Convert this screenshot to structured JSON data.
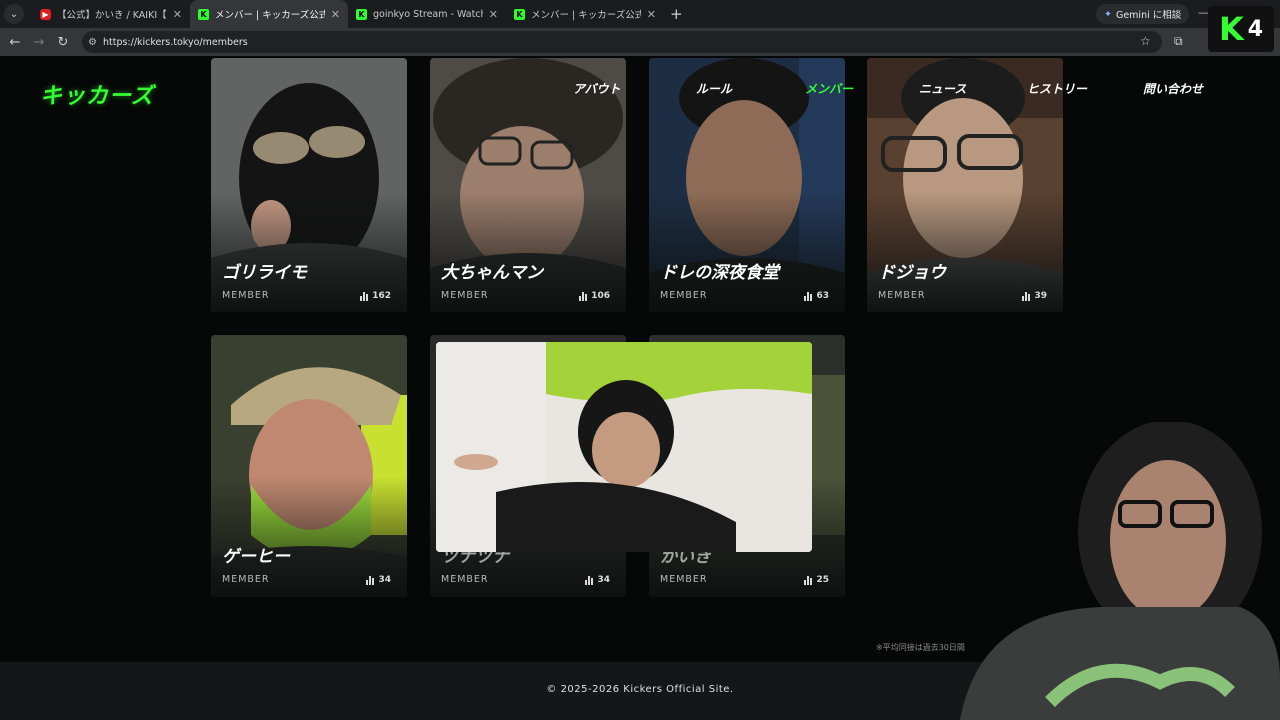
{
  "browser": {
    "tabs": [
      {
        "title": "【公式】かいき / KAIKI【キッカーズ 三",
        "icon": "youtube-icon",
        "active": false
      },
      {
        "title": "メンバー | キッカーズ公式サイト",
        "icon": "kickers-favicon",
        "active": true
      },
      {
        "title": "goinkyo Stream - Watch Live o",
        "icon": "kickers-favicon",
        "active": false
      },
      {
        "title": "メンバー | キッカーズ公式サイト",
        "icon": "kickers-favicon",
        "active": false
      }
    ],
    "gemini_label": "Gemini に相談",
    "url": "https://kickers.tokyo/members"
  },
  "site": {
    "logo": "キッカーズ",
    "nav": [
      "アバウト",
      "ルール",
      "メンバー",
      "ニュース",
      "ヒストリー",
      "問い合わせ"
    ],
    "active_nav": "メンバー"
  },
  "members": [
    {
      "name": "ゴリライモ",
      "role": "MEMBER",
      "count": "162"
    },
    {
      "name": "大ちゃんマン",
      "role": "MEMBER",
      "count": "106"
    },
    {
      "name": "ドレの深夜食堂",
      "role": "MEMBER",
      "count": "63"
    },
    {
      "name": "ドジョウ",
      "role": "MEMBER",
      "count": "39"
    },
    {
      "name": "ゲーヒー",
      "role": "MEMBER",
      "count": "34"
    },
    {
      "name": "ツナツナ",
      "role": "MEMBER",
      "count": "34"
    },
    {
      "name": "かいき",
      "role": "MEMBER",
      "count": "25"
    }
  ],
  "note": "※平均同接は過去30日間",
  "footer": "© 2025-2026 Kickers Official Site.",
  "overlay_badge": {
    "letter": "K",
    "number": "4"
  },
  "colors": {
    "accent": "#33ff33",
    "background": "#060707",
    "footer": "#141617"
  }
}
